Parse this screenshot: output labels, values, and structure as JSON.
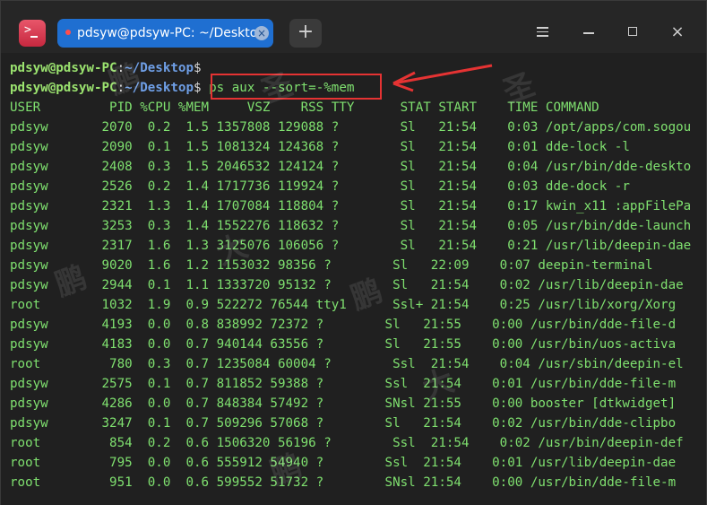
{
  "window": {
    "tab_title": "pdsyw@pdsyw-PC: ~/Desktop",
    "new_tab_symbol": "+",
    "buttons": {
      "menu_icon": "menu-icon",
      "minimize_icon": "minimize-icon",
      "maximize_icon": "maximize-icon",
      "close_icon": "close-icon"
    }
  },
  "terminal": {
    "prompt_user": "pdsyw@pdsyw-PC",
    "prompt_path": "~/Desktop",
    "prompt_symbol": "$",
    "command": "ps aux --sort=-%mem",
    "header": "USER         PID %CPU %MEM     VSZ    RSS TTY      STAT START    TIME COMMAND",
    "rows": [
      "pdsyw       2070  0.2  1.5 1357808 129088 ?        Sl   21:54    0:03 /opt/apps/com.sogou",
      "pdsyw       2090  0.1  1.5 1081324 124368 ?        Sl   21:54    0:01 dde-lock -l",
      "pdsyw       2408  0.3  1.5 2046532 124124 ?        Sl   21:54    0:04 /usr/bin/dde-deskto",
      "pdsyw       2526  0.2  1.4 1717736 119924 ?        Sl   21:54    0:03 dde-dock -r",
      "pdsyw       2321  1.3  1.4 1707084 118804 ?        Sl   21:54    0:17 kwin_x11 :appFilePa",
      "pdsyw       3253  0.3  1.4 1552276 118632 ?        Sl   21:54    0:05 /usr/bin/dde-launch",
      "pdsyw       2317  1.6  1.3 3125076 106056 ?        Sl   21:54    0:21 /usr/lib/deepin-dae",
      "pdsyw       9020  1.6  1.2 1153032 98356 ?        Sl   22:09    0:07 deepin-terminal",
      "pdsyw       2944  0.1  1.1 1333720 95132 ?        Sl   21:54    0:02 /usr/lib/deepin-dae",
      "root        1032  1.9  0.9 522272 76544 tty1      Ssl+ 21:54    0:25 /usr/lib/xorg/Xorg",
      "pdsyw       4193  0.0  0.8 838992 72372 ?        Sl   21:55    0:00 /usr/bin/dde-file-d",
      "pdsyw       4183  0.0  0.7 940144 63556 ?        Sl   21:55    0:00 /usr/bin/uos-activa",
      "root         780  0.3  0.7 1235084 60004 ?        Ssl  21:54    0:04 /usr/sbin/deepin-el",
      "pdsyw       2575  0.1  0.7 811852 59388 ?        Ssl  21:54    0:01 /usr/bin/dde-file-m",
      "pdsyw       4286  0.0  0.7 848384 57492 ?        SNsl 21:55    0:00 booster [dtkwidget]",
      "pdsyw       3247  0.1  0.7 509296 57068 ?        Sl   21:54    0:02 /usr/bin/dde-clipbo",
      "root         854  0.2  0.6 1506320 56196 ?        Ssl  21:54    0:02 /usr/bin/deepin-def",
      "root         795  0.0  0.6 555912 54940 ?        Ssl  21:54    0:01 /usr/lib/deepin-dae",
      "root         951  0.0  0.6 599552 51732 ?        SNsl 21:54    0:00 /usr/bin/dde-file-m"
    ]
  },
  "annotation": {
    "highlight_color": "#e53333"
  },
  "watermark": {
    "glyphs": [
      "鹏",
      "大",
      "圣"
    ]
  }
}
